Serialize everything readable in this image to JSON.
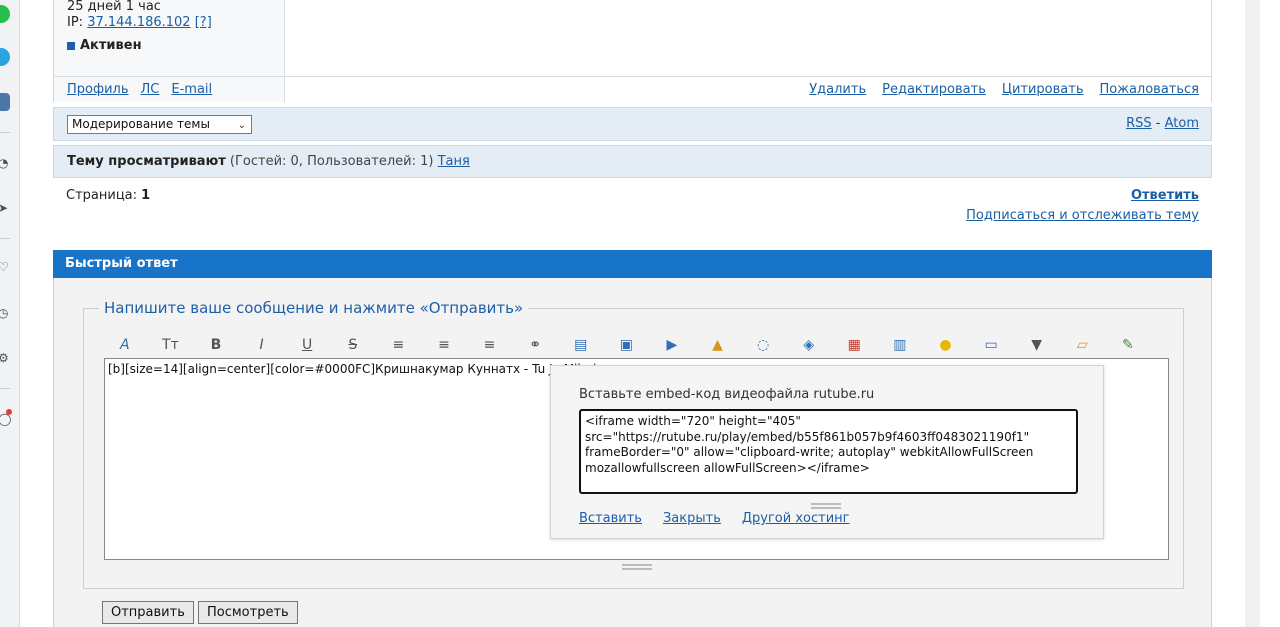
{
  "post": {
    "time_line": "25 дней 1 час",
    "ip_label": "IP:",
    "ip_value": "37.144.186.102",
    "ip_help": "[?]",
    "status": "Активен",
    "links_left": [
      "Профиль",
      "ЛС",
      "E-mail"
    ],
    "links_right": [
      "Удалить",
      "Редактировать",
      "Цитировать",
      "Пожаловаться"
    ]
  },
  "moderation": {
    "selected": "Модерирование темы",
    "rss": "RSS",
    "separator": "-",
    "atom": "Atom"
  },
  "viewers": {
    "label": "Тему просматривают",
    "counts": "(Гостей: 0, Пользователей: 1)",
    "user": "Таня"
  },
  "pager": {
    "label": "Страница:",
    "current": "1",
    "reply": "Ответить",
    "subscribe": "Подписаться и отслеживать тему"
  },
  "quick_reply": {
    "title": "Быстрый ответ",
    "legend": "Напишите ваше сообщение и нажмите «Отправить»",
    "text": "[b][size=14][align=center][color=#0000FC]Кришнакумар Куннатх - Tu Jo Mila (",
    "submit": "Отправить",
    "preview": "Посмотреть"
  },
  "toolbar": [
    {
      "name": "font-icon",
      "glyph": "A",
      "style": "blue"
    },
    {
      "name": "size-icon",
      "glyph": "Tт",
      "style": ""
    },
    {
      "name": "bold-icon",
      "glyph": "B",
      "style": ""
    },
    {
      "name": "italic-icon",
      "glyph": "I",
      "style": ""
    },
    {
      "name": "underline-icon",
      "glyph": "U",
      "style": ""
    },
    {
      "name": "strike-icon",
      "glyph": "S",
      "style": ""
    },
    {
      "name": "align-left-icon",
      "glyph": "≡",
      "style": ""
    },
    {
      "name": "align-center-icon",
      "glyph": "≡",
      "style": ""
    },
    {
      "name": "align-right-icon",
      "glyph": "≡",
      "style": ""
    },
    {
      "name": "link-icon",
      "glyph": "⚭",
      "style": ""
    },
    {
      "name": "book-icon",
      "glyph": "▤",
      "style": "blue"
    },
    {
      "name": "image-icon",
      "glyph": "▣",
      "style": "blue"
    },
    {
      "name": "video-icon",
      "glyph": "▶",
      "style": "blue"
    },
    {
      "name": "lock-icon",
      "glyph": "▲",
      "style": "orange"
    },
    {
      "name": "quote-icon",
      "glyph": "◌",
      "style": "blue"
    },
    {
      "name": "code-icon",
      "glyph": "◈",
      "style": "blue"
    },
    {
      "name": "palette-icon",
      "glyph": "▦",
      "style": "multi"
    },
    {
      "name": "table-icon",
      "glyph": "▥",
      "style": "blue"
    },
    {
      "name": "smile-icon",
      "glyph": "●",
      "style": "yellow"
    },
    {
      "name": "keyboard-icon",
      "glyph": "▭",
      "style": "blue"
    },
    {
      "name": "more-icon",
      "glyph": "▼",
      "style": ""
    },
    {
      "name": "folder-icon",
      "glyph": "▱",
      "style": "orange"
    },
    {
      "name": "edit-icon",
      "glyph": "✎",
      "style": "green"
    }
  ],
  "embed_popup": {
    "title": "Вставьте embed-код видеофайла rutube.ru",
    "code": "<iframe width=\"720\" height=\"405\"\nsrc=\"https://rutube.ru/play/embed/b55f861b057b9f4603ff0483021190f1\"\nframeBorder=\"0\" allow=\"clipboard-write; autoplay\" webkitAllowFullScreen\nmozallowfullscreen allowFullScreen></iframe>",
    "insert": "Вставить",
    "close": "Закрыть",
    "other": "Другой хостинг"
  },
  "colors": {
    "header_blue": "#1874c9",
    "link": "#1a5fa6",
    "bar_bg": "#e4edf6"
  }
}
